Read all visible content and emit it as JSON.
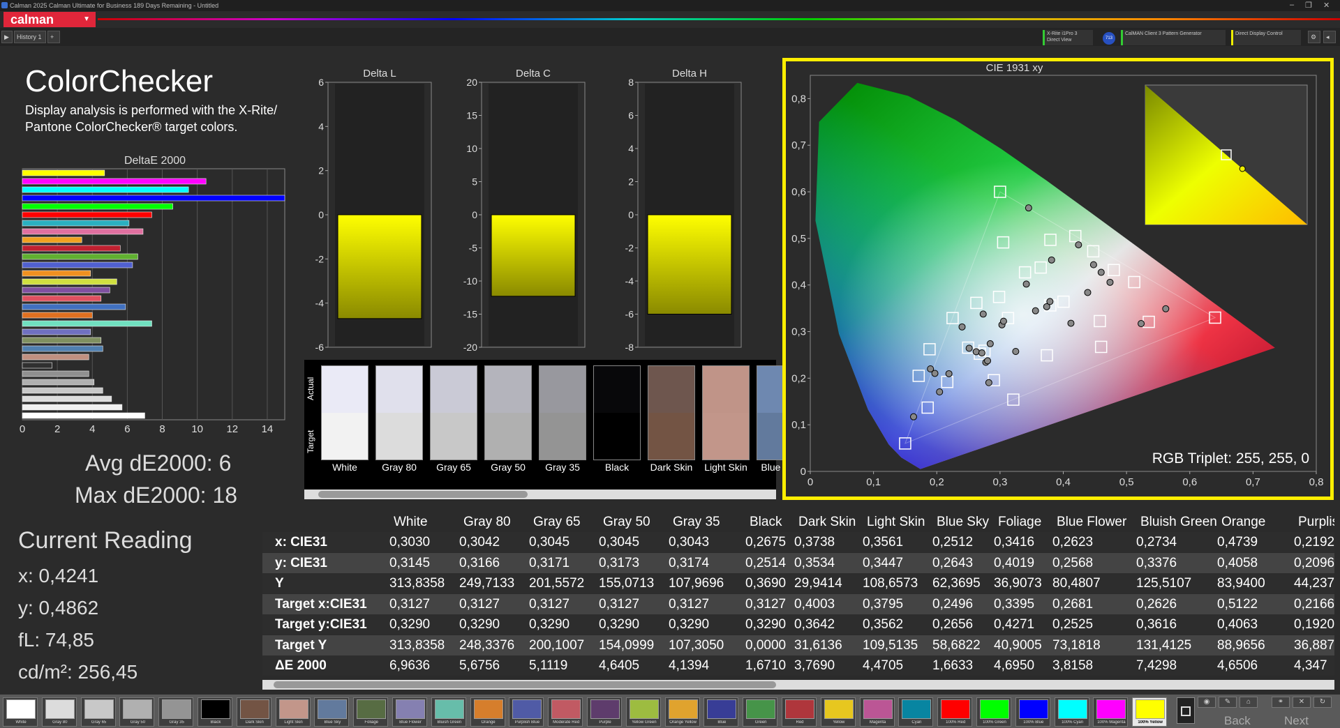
{
  "window": {
    "title": "Calman 2025 Calman Ultimate for Business 189 Days Remaining  - Untitled",
    "min": "–",
    "max": "❐",
    "close": "✕"
  },
  "app": {
    "logo": "calman",
    "dropdown": "▼"
  },
  "toolbar": {
    "history_tab": "History 1",
    "add_tab": "+",
    "play": "▶",
    "meter": "X-Rite i1Pro 3",
    "meter_mode": "Direct View",
    "meter_badge": "713",
    "generator": "CalMAN Client 3 Pattern Generator",
    "display_control": "Direct Display Control"
  },
  "page": {
    "title": "ColorChecker",
    "description": "Display analysis is performed with the X-Rite/ Pantone ColorChecker® target colors."
  },
  "deltae": {
    "title": "DeltaE 2000",
    "avg": "Avg dE2000: 6",
    "max": "Max dE2000: 18"
  },
  "current_reading": {
    "title": "Current Reading",
    "x": "x: 0,4241",
    "y": "y: 0,4862",
    "fl": "fL: 74,85",
    "cdm2": "cd/m²: 256,45"
  },
  "chart_data": [
    {
      "type": "bar",
      "title": "DeltaE 2000",
      "orientation": "horizontal",
      "xlim": [
        0,
        15
      ],
      "xticks": [
        0,
        2,
        4,
        6,
        8,
        10,
        12,
        14
      ],
      "values": [
        4.7,
        10.5,
        9.5,
        18,
        8.6,
        7.4,
        6.1,
        6.9,
        3.4,
        5.6,
        6.6,
        6.3,
        3.9,
        5.4,
        5,
        4.5,
        5.9,
        4,
        7.4,
        3.9,
        4.5,
        4.6,
        3.8,
        1.7,
        3.8,
        4.1,
        4.6,
        5.1,
        5.7,
        7
      ],
      "colors": [
        "#ffff00",
        "#ff00ff",
        "#00ffff",
        "#0000ff",
        "#00ff00",
        "#ff0000",
        "#2ab0c0",
        "#e070a0",
        "#f0a020",
        "#c02030",
        "#60b030",
        "#5060d0",
        "#f09020",
        "#d0e040",
        "#8050a0",
        "#e05060",
        "#4070c0",
        "#e07020",
        "#70e0c0",
        "#7070c0",
        "#809060",
        "#5080b0",
        "#c09080",
        "#303030",
        "#909090",
        "#b0b0b0",
        "#c8c8c8",
        "#dcdcdc",
        "#f0f0f0",
        "#ffffff"
      ]
    },
    {
      "type": "bar",
      "title": "Delta L",
      "ylim": [
        -6,
        6
      ],
      "yticks": [
        6,
        4,
        2,
        0,
        -2,
        -4,
        -6
      ],
      "values": [
        -4.7
      ]
    },
    {
      "type": "bar",
      "title": "Delta C",
      "ylim": [
        -20,
        20
      ],
      "yticks": [
        20,
        15,
        10,
        5,
        0,
        -5,
        -10,
        -15,
        -20
      ],
      "values": [
        -12.3
      ]
    },
    {
      "type": "bar",
      "title": "Delta H",
      "ylim": [
        -8,
        8
      ],
      "yticks": [
        8,
        6,
        4,
        2,
        0,
        -2,
        -4,
        -6,
        -8
      ],
      "values": [
        -6.0
      ]
    },
    {
      "type": "scatter",
      "title": "CIE 1931 xy",
      "xlim": [
        0,
        0.8
      ],
      "ylim": [
        0,
        0.85
      ],
      "xticks": [
        "0",
        "0,1",
        "0,2",
        "0,3",
        "0,4",
        "0,5",
        "0,6",
        "0,7",
        "0,8"
      ],
      "yticks": [
        "0",
        "0,1",
        "0,2",
        "0,3",
        "0,4",
        "0,5",
        "0,6",
        "0,7",
        "0,8"
      ],
      "targets": [
        [
          0.64,
          0.33
        ],
        [
          0.3,
          0.6
        ],
        [
          0.15,
          0.06
        ],
        [
          0.225,
          0.329
        ],
        [
          0.321,
          0.154
        ],
        [
          0.419,
          0.505
        ],
        [
          0.3127,
          0.329
        ],
        [
          0.4003,
          0.3642
        ],
        [
          0.3795,
          0.3562
        ],
        [
          0.2496,
          0.2656
        ],
        [
          0.3395,
          0.4271
        ],
        [
          0.2681,
          0.2525
        ],
        [
          0.2626,
          0.3616
        ],
        [
          0.5122,
          0.4063
        ],
        [
          0.2166,
          0.192
        ],
        [
          0.4598,
          0.2672
        ],
        [
          0.2903,
          0.1957
        ],
        [
          0.3796,
          0.4969
        ],
        [
          0.4799,
          0.4321
        ],
        [
          0.1856,
          0.1369
        ],
        [
          0.305,
          0.4914
        ],
        [
          0.5352,
          0.3209
        ],
        [
          0.4474,
          0.4723
        ],
        [
          0.3741,
          0.2491
        ],
        [
          0.1886,
          0.2621
        ],
        [
          0.1714,
          0.2051
        ],
        [
          0.2754,
          0.2589
        ],
        [
          0.2985,
          0.3744
        ],
        [
          0.3643,
          0.4375
        ],
        [
          0.4578,
          0.3226
        ]
      ],
      "actuals": [
        [
          0.3416,
          0.4019
        ],
        [
          0.4739,
          0.4058
        ],
        [
          0.2623,
          0.2568
        ],
        [
          0.2734,
          0.3376
        ],
        [
          0.3738,
          0.3534
        ],
        [
          0.3561,
          0.3447
        ],
        [
          0.2512,
          0.2643
        ],
        [
          0.303,
          0.3145
        ],
        [
          0.2192,
          0.2096
        ],
        [
          0.1633,
          0.1172
        ],
        [
          0.3452,
          0.5654
        ],
        [
          0.4241,
          0.4862
        ],
        [
          0.562,
          0.349
        ],
        [
          0.2775,
          0.234
        ],
        [
          0.19,
          0.22
        ],
        [
          0.2845,
          0.274
        ],
        [
          0.24,
          0.31
        ],
        [
          0.3248,
          0.2574
        ],
        [
          0.2803,
          0.2373
        ],
        [
          0.2823,
          0.1904
        ],
        [
          0.2044,
          0.1706
        ],
        [
          0.4599,
          0.4272
        ],
        [
          0.4121,
          0.3179
        ],
        [
          0.3815,
          0.4537
        ],
        [
          0.4386,
          0.3839
        ],
        [
          0.2713,
          0.2542
        ],
        [
          0.197,
          0.2103
        ],
        [
          0.3056,
          0.3223
        ],
        [
          0.4479,
          0.4435
        ],
        [
          0.3789,
          0.3646
        ],
        [
          0.5231,
          0.3172
        ]
      ],
      "inset_title": "",
      "inset_targets": [
        [
          0.7,
          0.3
        ]
      ],
      "inset_actuals": [
        [
          0.72,
          0.28
        ]
      ],
      "rgb_triplet": "RGB Triplet: 255, 255, 0"
    }
  ],
  "swatches": {
    "actual_label": "Actual",
    "target_label": "Target",
    "items": [
      {
        "name": "White",
        "actual": "#eaeaf6",
        "target": "#f2f2f2"
      },
      {
        "name": "Gray 80",
        "actual": "#e0e0ec",
        "target": "#dcdcdc"
      },
      {
        "name": "Gray 65",
        "actual": "#cacad6",
        "target": "#c8c8c8"
      },
      {
        "name": "Gray 50",
        "actual": "#b4b4bc",
        "target": "#b0b0b0"
      },
      {
        "name": "Gray 35",
        "actual": "#98989e",
        "target": "#949494"
      },
      {
        "name": "Black",
        "actual": "#08080a",
        "target": "#000000"
      },
      {
        "name": "Dark Skin",
        "actual": "#6e564e",
        "target": "#735444"
      },
      {
        "name": "Light Skin",
        "actual": "#c09488",
        "target": "#c2968a"
      },
      {
        "name": "Blue Sky",
        "actual": "#6e88b0",
        "target": "#627a9d"
      }
    ]
  },
  "table": {
    "columns": [
      "",
      "White",
      "Gray 80",
      "Gray 65",
      "Gray 50",
      "Gray 35",
      "Black",
      "Dark Skin",
      "Light Skin",
      "Blue Sky",
      "Foliage",
      "Blue Flower",
      "Bluish Green",
      "Orange",
      "Purplish"
    ],
    "rows": [
      {
        "label": "x: CIE31",
        "cells": [
          "0,3030",
          "0,3042",
          "0,3045",
          "0,3045",
          "0,3043",
          "0,2675",
          "0,3738",
          "0,3561",
          "0,2512",
          "0,3416",
          "0,2623",
          "0,2734",
          "0,4739",
          "0,2192"
        ]
      },
      {
        "label": "y: CIE31",
        "cells": [
          "0,3145",
          "0,3166",
          "0,3171",
          "0,3173",
          "0,3174",
          "0,2514",
          "0,3534",
          "0,3447",
          "0,2643",
          "0,4019",
          "0,2568",
          "0,3376",
          "0,4058",
          "0,2096"
        ]
      },
      {
        "label": "Y",
        "cells": [
          "313,8358",
          "249,7133",
          "201,5572",
          "155,0713",
          "107,9696",
          "0,3690",
          "29,9414",
          "108,6573",
          "62,3695",
          "36,9073",
          "80,4807",
          "125,5107",
          "83,9400",
          "44,237"
        ]
      },
      {
        "label": "Target x:CIE31",
        "cells": [
          "0,3127",
          "0,3127",
          "0,3127",
          "0,3127",
          "0,3127",
          "0,3127",
          "0,4003",
          "0,3795",
          "0,2496",
          "0,3395",
          "0,2681",
          "0,2626",
          "0,5122",
          "0,2166"
        ]
      },
      {
        "label": "Target y:CIE31",
        "cells": [
          "0,3290",
          "0,3290",
          "0,3290",
          "0,3290",
          "0,3290",
          "0,3290",
          "0,3642",
          "0,3562",
          "0,2656",
          "0,4271",
          "0,2525",
          "0,3616",
          "0,4063",
          "0,1920"
        ]
      },
      {
        "label": "Target Y",
        "cells": [
          "313,8358",
          "248,3376",
          "200,1007",
          "154,0999",
          "107,3050",
          "0,0000",
          "31,6136",
          "109,5135",
          "58,6822",
          "40,9005",
          "73,1818",
          "131,4125",
          "88,9656",
          "36,887"
        ]
      },
      {
        "label": "ΔE 2000",
        "cells": [
          "6,9636",
          "5,6756",
          "5,1119",
          "4,6405",
          "4,1394",
          "1,6710",
          "3,7690",
          "4,4705",
          "1,6633",
          "4,6950",
          "3,8158",
          "7,4298",
          "4,6506",
          "4,347"
        ]
      }
    ]
  },
  "patches": [
    {
      "name": "White",
      "color": "#ffffff"
    },
    {
      "name": "Gray 80",
      "color": "#dcdcdc"
    },
    {
      "name": "Gray 65",
      "color": "#c8c8c8"
    },
    {
      "name": "Gray 50",
      "color": "#b0b0b0"
    },
    {
      "name": "Gray 35",
      "color": "#949494"
    },
    {
      "name": "Black",
      "color": "#000000"
    },
    {
      "name": "Dark Skin",
      "color": "#735444"
    },
    {
      "name": "Light Skin",
      "color": "#c2968a"
    },
    {
      "name": "Blue Sky",
      "color": "#627a9d"
    },
    {
      "name": "Foliage",
      "color": "#576c43"
    },
    {
      "name": "Blue Flower",
      "color": "#8580b1"
    },
    {
      "name": "Bluish Green",
      "color": "#67bdaa"
    },
    {
      "name": "Orange",
      "color": "#d67e2c"
    },
    {
      "name": "Purplish Blue",
      "color": "#505ba6"
    },
    {
      "name": "Moderate Red",
      "color": "#c15a63"
    },
    {
      "name": "Purple",
      "color": "#5e3c6c"
    },
    {
      "name": "Yellow Green",
      "color": "#9dbc40"
    },
    {
      "name": "Orange Yellow",
      "color": "#e0a32e"
    },
    {
      "name": "Blue",
      "color": "#383d96"
    },
    {
      "name": "Green",
      "color": "#469449"
    },
    {
      "name": "Red",
      "color": "#af363c"
    },
    {
      "name": "Yellow",
      "color": "#e7c71f"
    },
    {
      "name": "Magenta",
      "color": "#bb5695"
    },
    {
      "name": "Cyan",
      "color": "#0885a1"
    },
    {
      "name": "100% Red",
      "color": "#ff0000"
    },
    {
      "name": "100% Green",
      "color": "#00ff00"
    },
    {
      "name": "100% Blue",
      "color": "#0000ff"
    },
    {
      "name": "100% Cyan",
      "color": "#00ffff"
    },
    {
      "name": "100% Magenta",
      "color": "#ff00ff"
    },
    {
      "name": "100% Yellow",
      "color": "#ffff00"
    }
  ],
  "nav": {
    "back": "Back",
    "next": "Next"
  }
}
